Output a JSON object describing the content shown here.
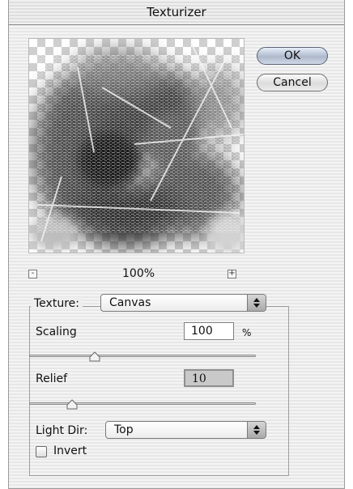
{
  "window": {
    "title": "Texturizer"
  },
  "buttons": {
    "ok": "OK",
    "cancel": "Cancel"
  },
  "zoom": {
    "minus": "-",
    "plus": "+",
    "level": "100%"
  },
  "texture": {
    "label": "Texture:",
    "value": "Canvas"
  },
  "scaling": {
    "label": "Scaling",
    "value": "100",
    "unit": "%",
    "slider_fraction": 0.29
  },
  "relief": {
    "label": "Relief",
    "value": "10",
    "slider_fraction": 0.19
  },
  "light_dir": {
    "label": "Light Dir:",
    "value": "Top"
  },
  "invert": {
    "label": "Invert",
    "checked": false
  },
  "colors": {
    "default_button": "#aeb9cc",
    "window_stripe": "#e7e7e7",
    "preview_check": "#cfcfcf"
  },
  "icons": [
    "popup-arrows-icon",
    "slider-thumb-icon",
    "zoom-out-icon",
    "zoom-in-icon"
  ]
}
